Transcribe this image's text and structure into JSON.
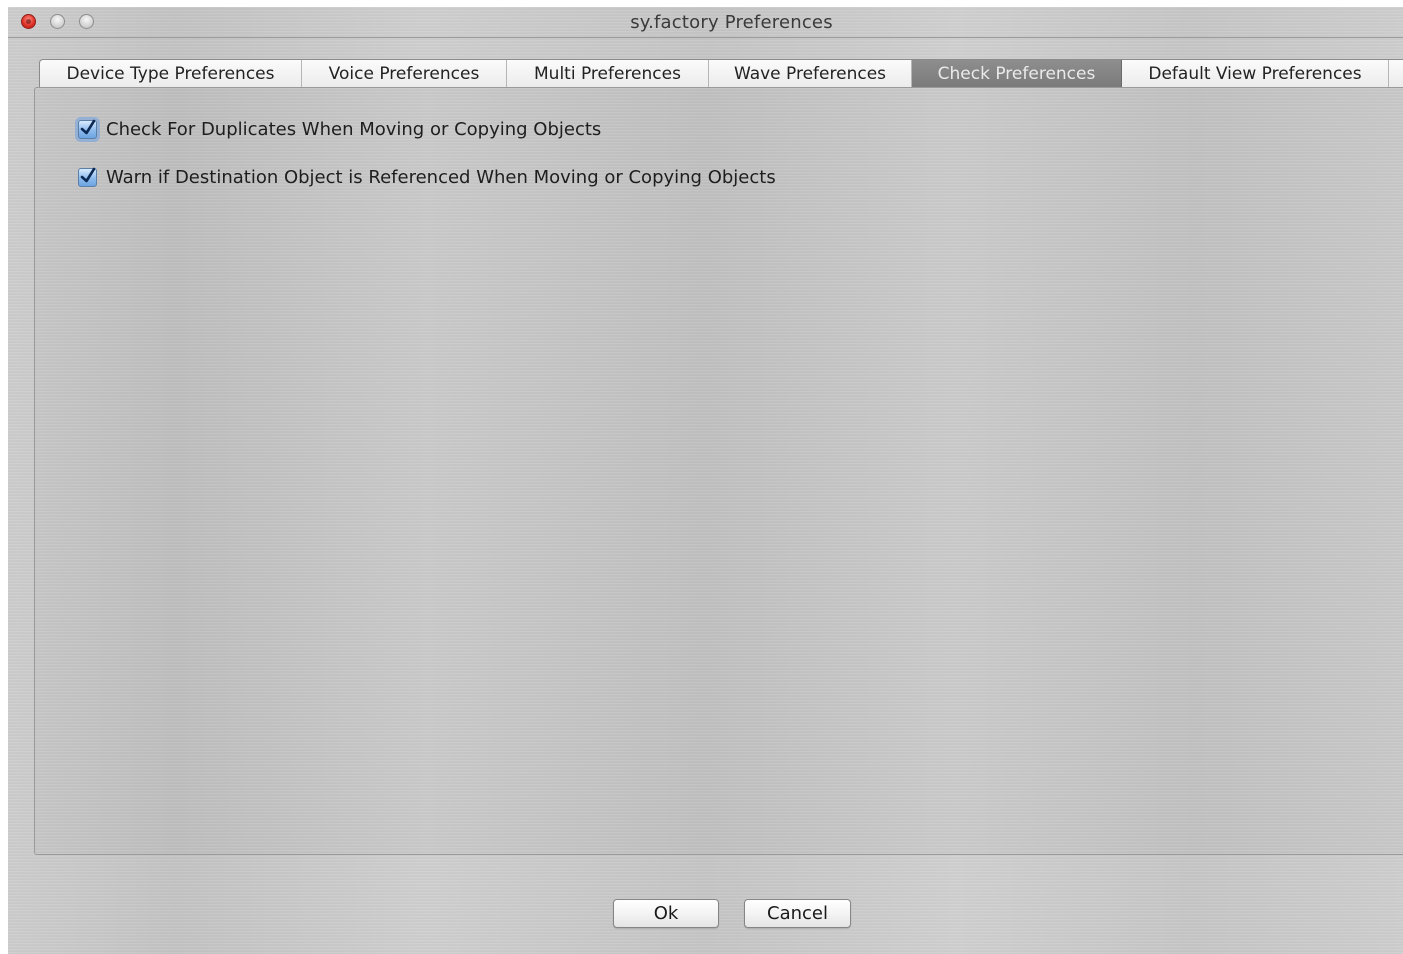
{
  "window": {
    "title": "sy.factory Preferences"
  },
  "tabs": [
    {
      "label": "Device Type Preferences",
      "active": false
    },
    {
      "label": "Voice Preferences",
      "active": false
    },
    {
      "label": "Multi Preferences",
      "active": false
    },
    {
      "label": "Wave Preferences",
      "active": false
    },
    {
      "label": "Check Preferences",
      "active": true
    },
    {
      "label": "Default View Preferences",
      "active": false
    }
  ],
  "checks": [
    {
      "label": "Check For Duplicates When Moving or Copying Objects",
      "checked": true
    },
    {
      "label": "Warn if Destination Object is Referenced When Moving or Copying Objects",
      "checked": true
    }
  ],
  "buttons": {
    "ok": "Ok",
    "cancel": "Cancel"
  },
  "colors": {
    "active_tab": "#7a7a7a",
    "checkbox_accent": "#6da3e0",
    "close_button": "#e0342a"
  }
}
